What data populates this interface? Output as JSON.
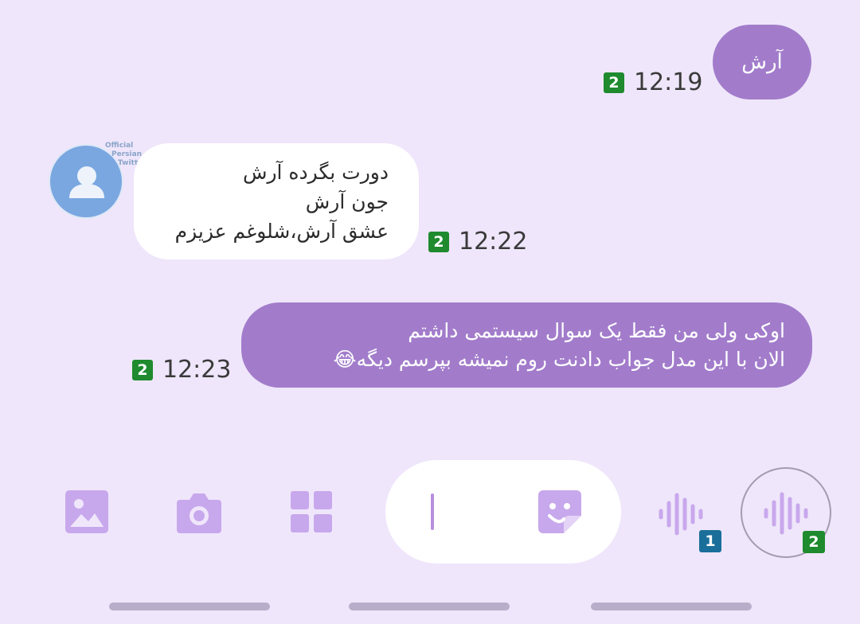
{
  "messages": [
    {
      "direction": "out",
      "lines": [
        "آرش"
      ],
      "time": "12:19",
      "sim": "2"
    },
    {
      "direction": "in",
      "lines": [
        "دورت بگرده آرش",
        "جون آرش",
        "عشق آرش،شلوغم عزیزم"
      ],
      "time": "12:22",
      "sim": "2"
    },
    {
      "direction": "out",
      "lines": [
        "اوکی ولی من فقط یک سوال سیستمی داشتم",
        "الان با این مدل جواب دادنت روم نمیشه بپرسم دیگه😂"
      ],
      "time": "12:23",
      "sim": "2"
    }
  ],
  "avatar": {
    "watermark": [
      "Official",
      "Persian",
      "Twitter"
    ]
  },
  "composer": {
    "gallery_icon": "image-icon",
    "camera_icon": "camera-icon",
    "apps_icon": "grid-icon",
    "sticker_icon": "sticker-icon",
    "voice_sim1_label": "1",
    "voice_sim2_label": "2"
  },
  "colors": {
    "background": "#efe6fb",
    "outgoing": "#a27ccb",
    "incoming": "#ffffff",
    "accent": "#c8a8ec"
  }
}
